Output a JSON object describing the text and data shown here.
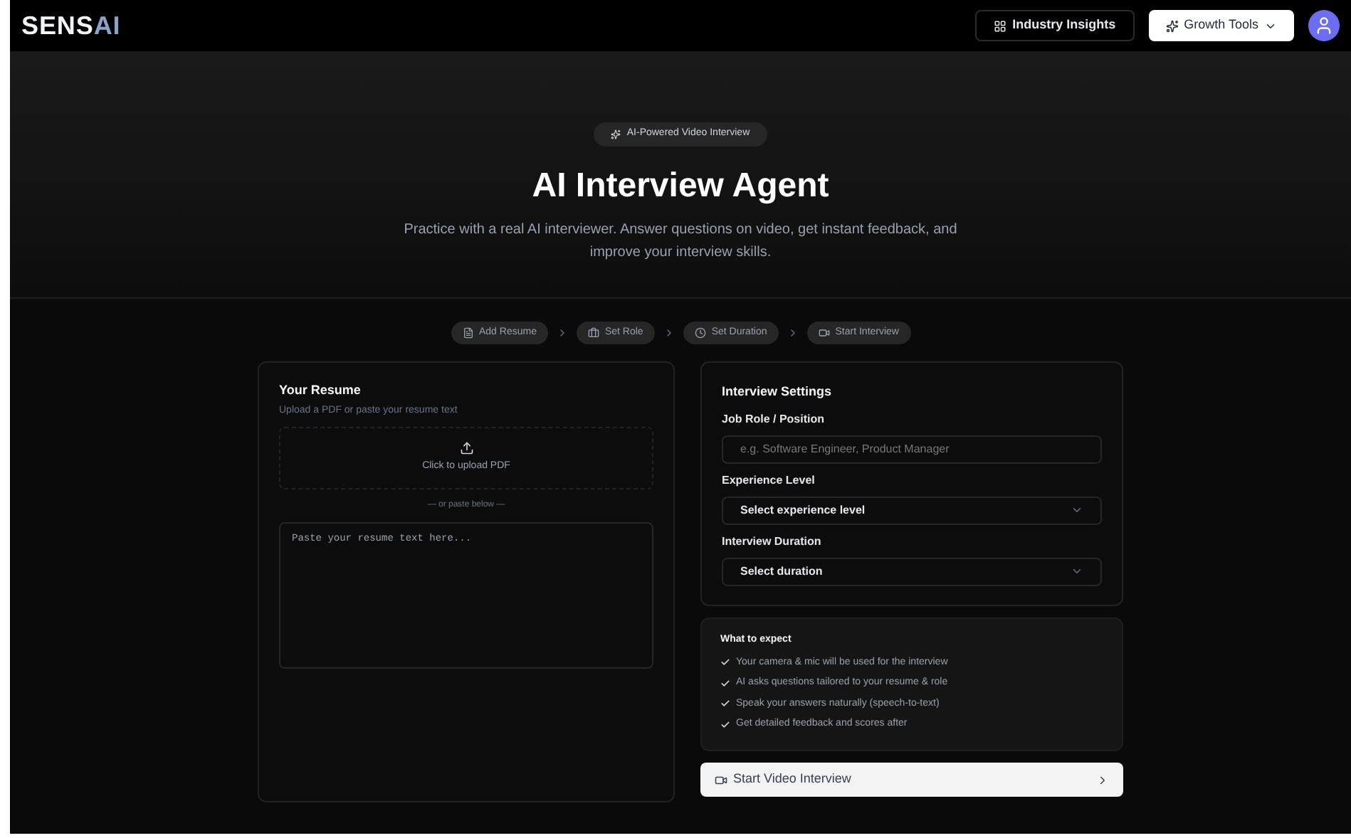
{
  "header": {
    "logo": {
      "text": "SENS",
      "accent": "AI"
    },
    "nav": [
      {
        "kind": "link",
        "label": "Industry Insights"
      },
      {
        "kind": "dropdown",
        "label": "Growth Tools"
      }
    ]
  },
  "hero": {
    "badge": "AI-Powered Video Interview",
    "title": "AI Interview Agent",
    "subtitle": "Practice with a real AI interviewer. Answer questions on video, get instant feedback, and improve your interview skills."
  },
  "steps": [
    {
      "label": "Add Resume"
    },
    {
      "label": "Set Role"
    },
    {
      "label": "Set Duration"
    },
    {
      "label": "Start Interview"
    }
  ],
  "resume": {
    "title": "Your Resume",
    "subtitle": "Upload a PDF or paste your resume text",
    "upload_label": "Click to upload PDF",
    "divider": "— or paste below —",
    "textarea_placeholder": "Paste your resume text here..."
  },
  "settings": {
    "title": "Interview Settings",
    "fields": [
      {
        "kind": "input",
        "label": "Job Role / Position",
        "placeholder": "e.g. Software Engineer, Product Manager"
      },
      {
        "kind": "select",
        "label": "Experience Level",
        "value": "Select experience level"
      },
      {
        "kind": "select",
        "label": "Interview Duration",
        "value": "Select duration"
      }
    ]
  },
  "expect": {
    "title": "What to expect",
    "items": [
      "Your camera & mic will be used for the interview",
      "AI asks questions tailored to your resume & role",
      "Speak your answers naturally (speech-to-text)",
      "Get detailed feedback and scores after"
    ]
  },
  "start_button": "Start Video Interview"
}
